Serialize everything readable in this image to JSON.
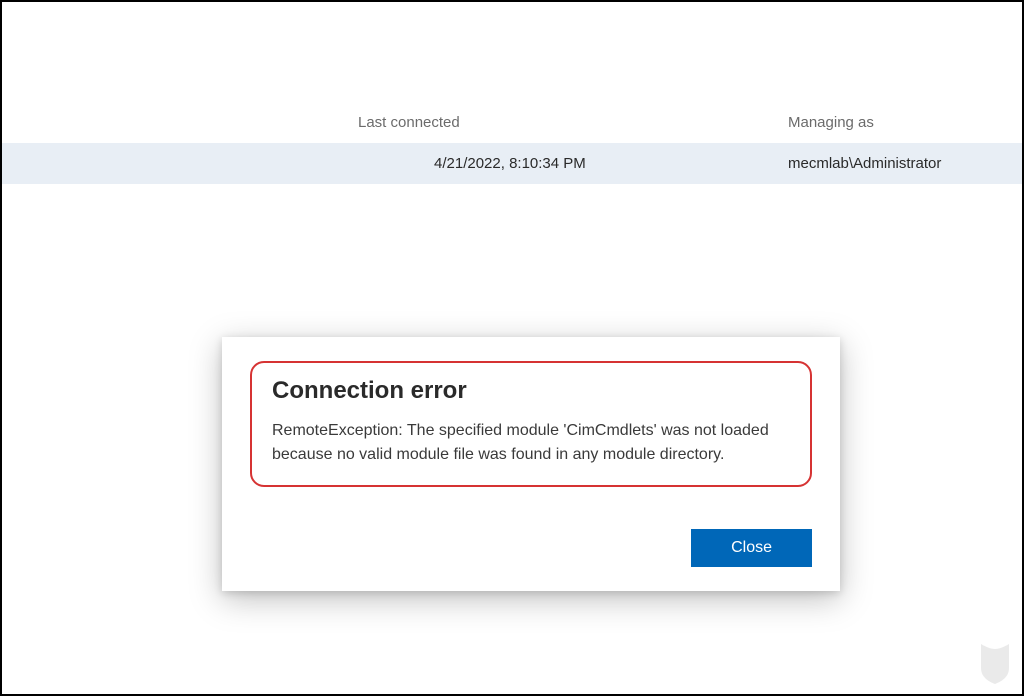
{
  "table": {
    "headers": {
      "last_connected": "Last connected",
      "managing_as": "Managing as"
    },
    "row": {
      "last_connected": "4/21/2022, 8:10:34 PM",
      "managing_as": "mecmlab\\Administrator"
    }
  },
  "dialog": {
    "title": "Connection error",
    "message": "RemoteException: The specified module 'CimCmdlets' was not loaded because no valid module file was found in any module directory.",
    "close_label": "Close"
  }
}
